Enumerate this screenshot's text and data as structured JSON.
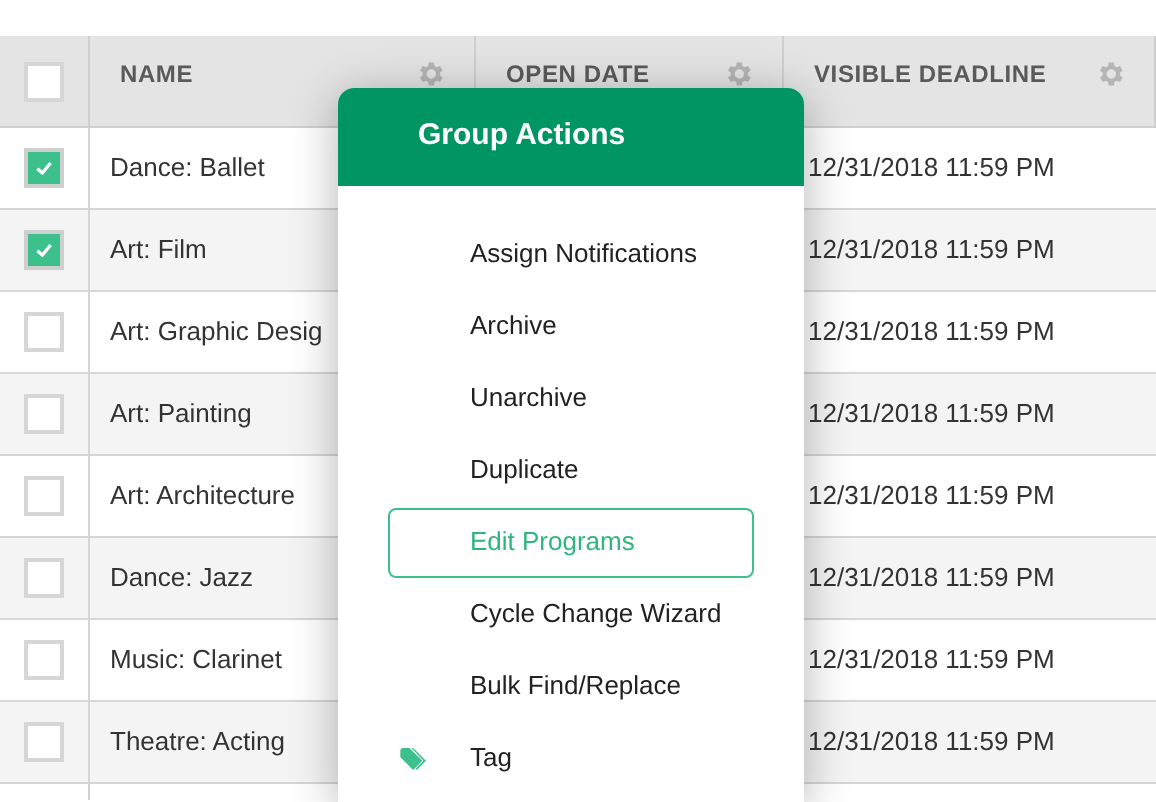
{
  "table": {
    "select_all": {
      "checked": false
    },
    "columns": [
      {
        "label": "NAME"
      },
      {
        "label": "OPEN DATE"
      },
      {
        "label": "VISIBLE DEADLINE"
      }
    ],
    "rows": [
      {
        "checked": true,
        "name": "Dance: Ballet",
        "deadline": "12/31/2018 11:59 PM"
      },
      {
        "checked": true,
        "name": "Art: Film",
        "deadline": "12/31/2018 11:59 PM"
      },
      {
        "checked": false,
        "name": "Art: Graphic Desig",
        "deadline": "12/31/2018 11:59 PM"
      },
      {
        "checked": false,
        "name": "Art: Painting",
        "deadline": "12/31/2018 11:59 PM"
      },
      {
        "checked": false,
        "name": "Art: Architecture",
        "deadline": "12/31/2018 11:59 PM"
      },
      {
        "checked": false,
        "name": "Dance: Jazz",
        "deadline": "12/31/2018 11:59 PM"
      },
      {
        "checked": false,
        "name": "Music: Clarinet",
        "deadline": "12/31/2018 11:59 PM"
      },
      {
        "checked": false,
        "name": "Theatre: Acting",
        "deadline": "12/31/2018 11:59 PM"
      }
    ]
  },
  "menu": {
    "title": "Group Actions",
    "items": [
      {
        "label": "Assign Notifications",
        "selected": false
      },
      {
        "label": "Archive",
        "selected": false
      },
      {
        "label": "Unarchive",
        "selected": false
      },
      {
        "label": "Duplicate",
        "selected": false
      },
      {
        "label": "Edit Programs",
        "selected": true
      },
      {
        "label": "Cycle Change Wizard",
        "selected": false
      },
      {
        "label": "Bulk Find/Replace",
        "selected": false
      },
      {
        "label": "Tag",
        "selected": false,
        "kind": "tag"
      }
    ]
  }
}
